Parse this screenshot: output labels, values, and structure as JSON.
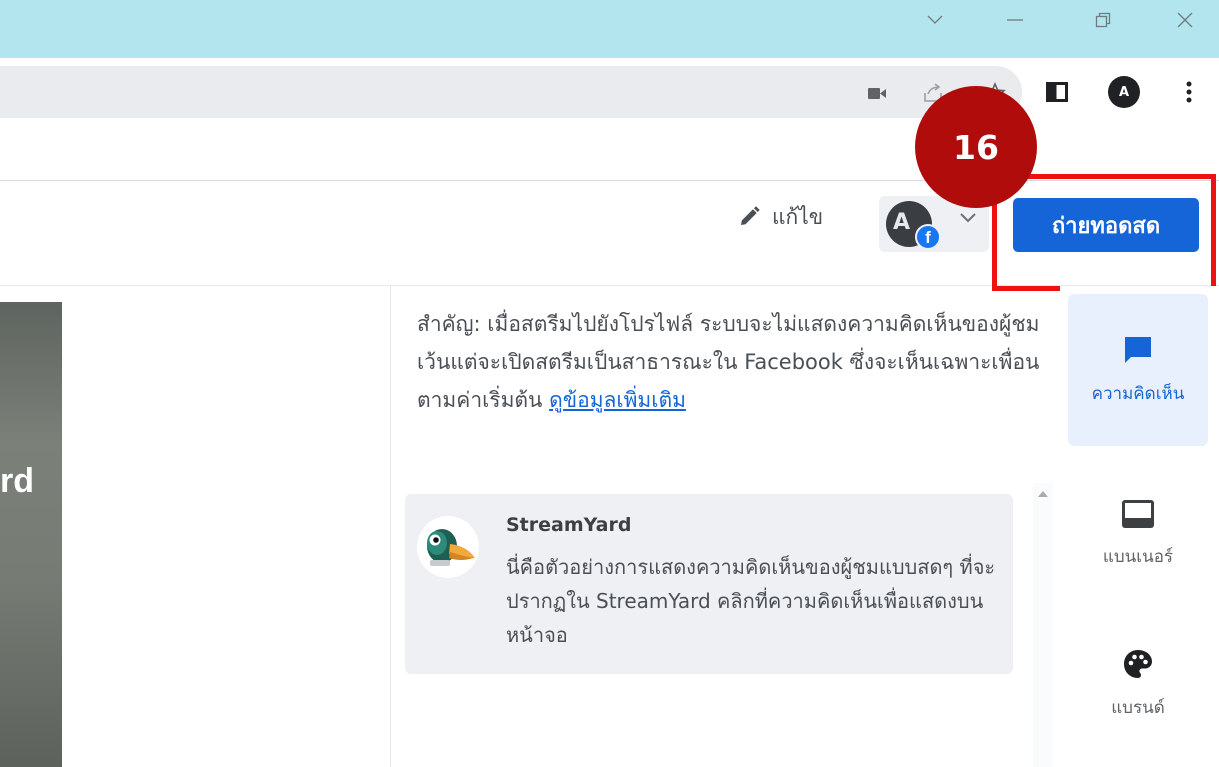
{
  "browser": {
    "window_controls": [
      "chevron-down",
      "minimize",
      "restore",
      "close"
    ],
    "profile_initial": "A"
  },
  "header": {
    "edit_label": "แก้ไข",
    "destination_avatar_letter": "A",
    "go_live_label": "ถ่ายทอดสด",
    "step_number": "16",
    "colors": {
      "go_live": "#1565d8",
      "highlight": "#ee1111",
      "step_badge": "#b00c0c"
    }
  },
  "stage": {
    "visible_text": "rd"
  },
  "comments": {
    "notice_text": "สำคัญ: เมื่อสตรีมไปยังโปรไฟล์ ระบบจะไม่แสดงความคิดเห็นของผู้ชม เว้นแต่จะเปิดสตรีมเป็นสาธารณะใน Facebook ซึ่งจะเห็นเฉพาะเพื่อนตามค่าเริ่มต้น ",
    "notice_link": "ดูข้อมูลเพิ่มเติม",
    "sample": {
      "author": "StreamYard",
      "text": "นี่คือตัวอย่างการแสดงความคิดเห็นของผู้ชมแบบสดๆ ที่จะปรากฏใน StreamYard คลิกที่ความคิดเห็นเพื่อแสดงบนหน้าจอ"
    }
  },
  "rail": {
    "items": [
      {
        "label": "ความคิดเห็น",
        "icon": "comment-icon",
        "active": true
      },
      {
        "label": "แบนเนอร์",
        "icon": "banner-icon",
        "active": false
      },
      {
        "label": "แบรนด์",
        "icon": "palette-icon",
        "active": false
      }
    ]
  }
}
